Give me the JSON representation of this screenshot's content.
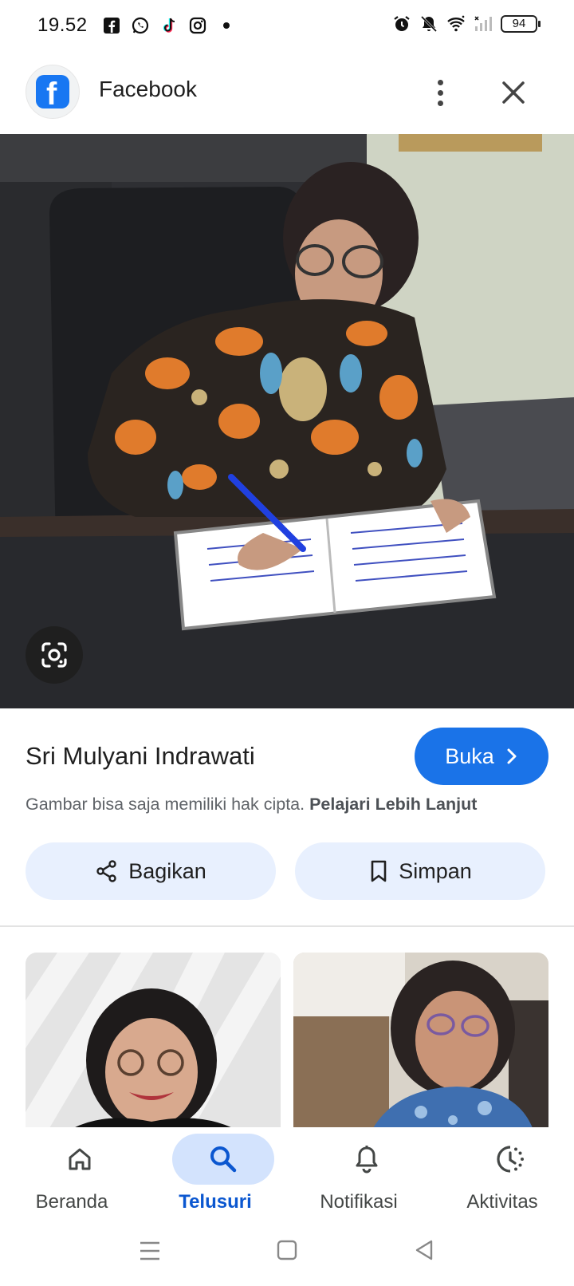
{
  "status_bar": {
    "time": "19.52",
    "battery": "94",
    "left_icons": [
      "facebook-icon",
      "whatsapp-icon",
      "tiktok-icon",
      "instagram-icon",
      "dot-icon"
    ],
    "right_icons": [
      "alarm-icon",
      "mute-icon",
      "wifi-icon",
      "signal-icon",
      "battery-icon"
    ]
  },
  "header": {
    "app_name": "Facebook",
    "logo_icon": "facebook-logo-icon",
    "more_icon": "more-vert-icon",
    "close_icon": "close-icon"
  },
  "image": {
    "lens_icon": "google-lens-icon"
  },
  "result": {
    "title": "Sri Mulyani Indrawati",
    "open_label": "Buka",
    "copyright_text": "Gambar bisa saja memiliki hak cipta.",
    "learn_more": "Pelajari Lebih Lanjut",
    "share_label": "Bagikan",
    "save_label": "Simpan"
  },
  "bottom_nav": {
    "items": [
      {
        "label": "Beranda",
        "icon": "home-icon",
        "active": false
      },
      {
        "label": "Telusuri",
        "icon": "search-icon",
        "active": true
      },
      {
        "label": "Notifikasi",
        "icon": "bell-icon",
        "active": false
      },
      {
        "label": "Aktivitas",
        "icon": "activity-icon",
        "active": false
      }
    ]
  },
  "colors": {
    "accent": "#1a73e8",
    "pill_bg": "#e8f0fe",
    "active_nav": "#0b57d0",
    "active_pill": "#d3e3fd"
  }
}
